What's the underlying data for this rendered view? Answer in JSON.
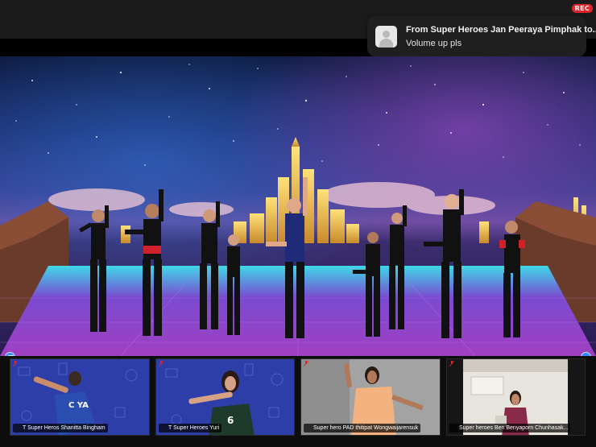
{
  "recording": {
    "label": "REC"
  },
  "notification": {
    "title": "From Super Heroes Jan Peeraya Pimphak to...",
    "message": "Volume up pls"
  },
  "gallery": {
    "participants": [
      {
        "name": "T Super Heros Shanitta Bingham",
        "muted": true
      },
      {
        "name": "T Super Heroes Yuri",
        "muted": true
      },
      {
        "name": "Super hero PAD thitipat Wongwaijarensuk",
        "muted": true
      },
      {
        "name": "Super heroes Ben Benyaporn Chunhasak...",
        "muted": true
      }
    ]
  },
  "colors": {
    "accent": "#2d8cff",
    "rec": "#e0252b",
    "muted_icon": "#e0252b"
  }
}
